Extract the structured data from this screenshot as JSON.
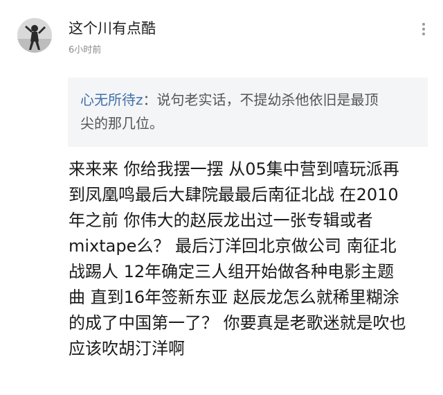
{
  "comment": {
    "username": "这个川有点酷",
    "time": "6小时前",
    "avatar_icon": "avatar-photo",
    "more_icon": "more-vertical-icon"
  },
  "quote": {
    "name": "心无所待z",
    "separator": "：",
    "line1": "说句老实话，不提幼杀他依旧是最顶",
    "line2": "尖的那几位。"
  },
  "body": {
    "lines": [
      "来来来 你给我摆一摆 从05集中营到嘻玩派再",
      "到凤凰鸣最后大肆院最最后南征北战 在2010",
      "年之前 你伟大的赵辰龙出过一张专辑或者",
      "mixtape么？ 最后汀洋回北京做公司 南征北",
      "战踢人 12年确定三人组开始做各种电影主题",
      "曲 直到16年签新东亚 赵辰龙怎么就稀里糊涂",
      "的成了中国第一了？ 你要真是老歌迷就是吹也",
      "应该吹胡汀洋啊"
    ]
  }
}
